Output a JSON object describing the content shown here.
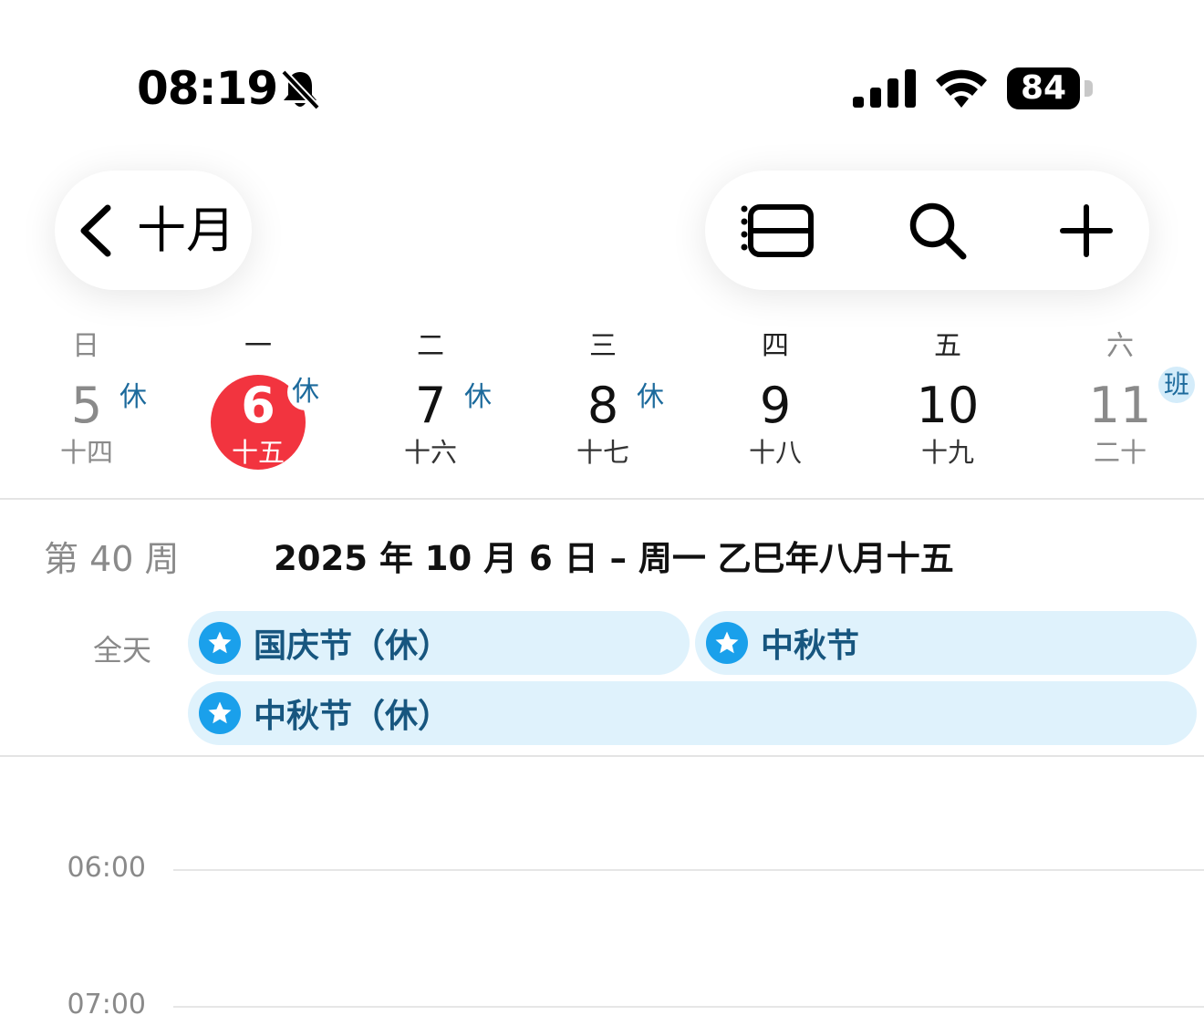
{
  "status_bar": {
    "time": "08:19",
    "battery": "84",
    "icons": [
      "bell-slash-icon",
      "cellular-signal-icon",
      "wifi-icon",
      "battery-icon"
    ]
  },
  "nav": {
    "back_label": "十月",
    "icons": [
      "chevron-left-icon",
      "list-view-icon",
      "search-icon",
      "plus-icon"
    ]
  },
  "week": {
    "weekdays": [
      "日",
      "一",
      "二",
      "三",
      "四",
      "五",
      "六"
    ],
    "days": [
      {
        "num": "5",
        "lunar": "十四",
        "badge": "休"
      },
      {
        "num": "6",
        "lunar": "十五",
        "badge": "休"
      },
      {
        "num": "7",
        "lunar": "十六",
        "badge": "休"
      },
      {
        "num": "8",
        "lunar": "十七",
        "badge": "休"
      },
      {
        "num": "9",
        "lunar": "十八",
        "badge": ""
      },
      {
        "num": "10",
        "lunar": "十九",
        "badge": ""
      },
      {
        "num": "11",
        "lunar": "二十",
        "badge": "班"
      }
    ],
    "today_color": "#f2343f"
  },
  "date_line": {
    "week_number": "第 40 周",
    "title": "2025 年 10 月 6 日 – 周一   乙巳年八月十五"
  },
  "all_day": {
    "label": "全天",
    "events": [
      {
        "title": "国庆节（休）"
      },
      {
        "title": "中秋节"
      },
      {
        "title": "中秋节（休）"
      }
    ],
    "event_color": "#1aa0eb"
  },
  "timeline": {
    "hours": [
      "06:00",
      "07:00"
    ]
  }
}
